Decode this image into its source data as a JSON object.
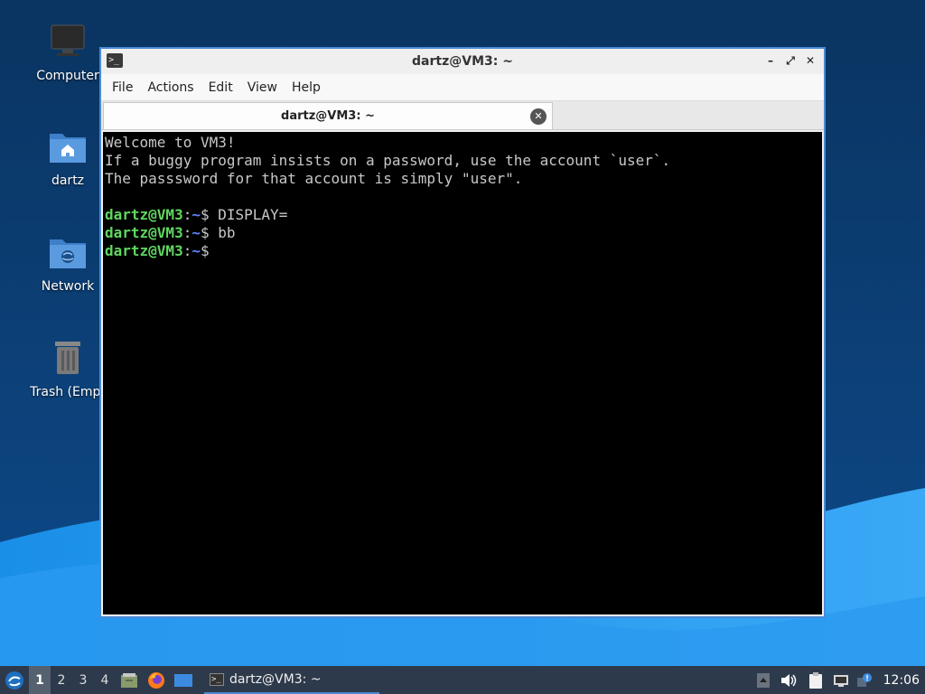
{
  "desktop": {
    "icons": [
      {
        "label": "Computer",
        "icon": "computer-icon"
      },
      {
        "label": "dartz",
        "icon": "home-folder-icon"
      },
      {
        "label": "Network",
        "icon": "network-folder-icon"
      },
      {
        "label": "Trash (Empt",
        "icon": "trash-icon"
      }
    ]
  },
  "window": {
    "title": "dartz@VM3: ~",
    "menu": [
      "File",
      "Actions",
      "Edit",
      "View",
      "Help"
    ],
    "tab_label": "dartz@VM3: ~"
  },
  "terminal": {
    "lines": [
      "Welcome to VM3!",
      "If a buggy program insists on a password, use the account `user`.",
      "The passsword for that account is simply \"user\"."
    ],
    "prompt_user": "dartz@VM3",
    "prompt_sep": ":",
    "prompt_path": "~",
    "prompt_sym": "$",
    "commands": [
      " DISPLAY=",
      " bb",
      ""
    ]
  },
  "taskbar": {
    "workspaces": [
      "1",
      "2",
      "3",
      "4"
    ],
    "active_workspace": "1",
    "task_label": "dartz@VM3: ~",
    "clock": "12:06"
  },
  "colors": {
    "prompt_user": "#5fd75f",
    "prompt_path": "#5f87ff",
    "accent": "#4a8ad4"
  }
}
